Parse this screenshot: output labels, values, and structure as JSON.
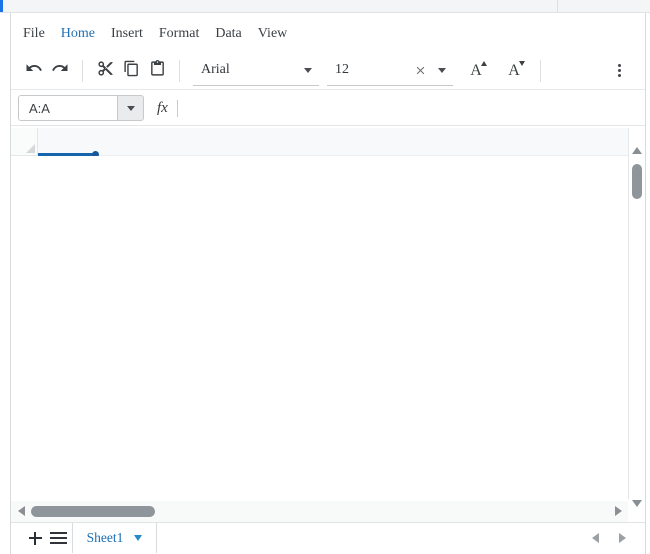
{
  "topbar": {
    "accent_color": "#1a73e8"
  },
  "menubar": {
    "items": [
      {
        "label": "File",
        "active": false
      },
      {
        "label": "Home",
        "active": true
      },
      {
        "label": "Insert",
        "active": false
      },
      {
        "label": "Format",
        "active": false
      },
      {
        "label": "Data",
        "active": false
      },
      {
        "label": "View",
        "active": false
      }
    ]
  },
  "toolbar": {
    "undo_icon": "undo-arrow",
    "redo_icon": "redo-arrow",
    "cut_icon": "scissors",
    "copy_icon": "copy-pages",
    "paste_icon": "clipboard",
    "font_family": {
      "value": "Arial"
    },
    "font_size": {
      "value": "12",
      "clear_icon": "x-clear"
    },
    "increase_font_label": "A",
    "decrease_font_label": "A",
    "more_icon": "vertical-ellipsis"
  },
  "formula_bar": {
    "name_box": {
      "value": "A:A"
    },
    "fx_label": "fx",
    "formula_value": ""
  },
  "grid": {
    "selected_range": "A:A",
    "selection_color": "#1565ad",
    "header_background": "#f8f9fa"
  },
  "sheet_bar": {
    "add_sheet_icon": "plus",
    "sheet_list_icon": "hamburger-menu",
    "tabs": [
      {
        "name": "Sheet1",
        "active": true
      }
    ],
    "tab_text_color": "#1a6fb5"
  },
  "colors": {
    "accent_blue": "#1a73e8",
    "menu_active_blue": "#2470b3",
    "selection_blue": "#1565ad",
    "icon_dark": "#3c4043",
    "scrollbar_thumb_gray": "#8f969b",
    "panel_border": "#d7dbde"
  }
}
